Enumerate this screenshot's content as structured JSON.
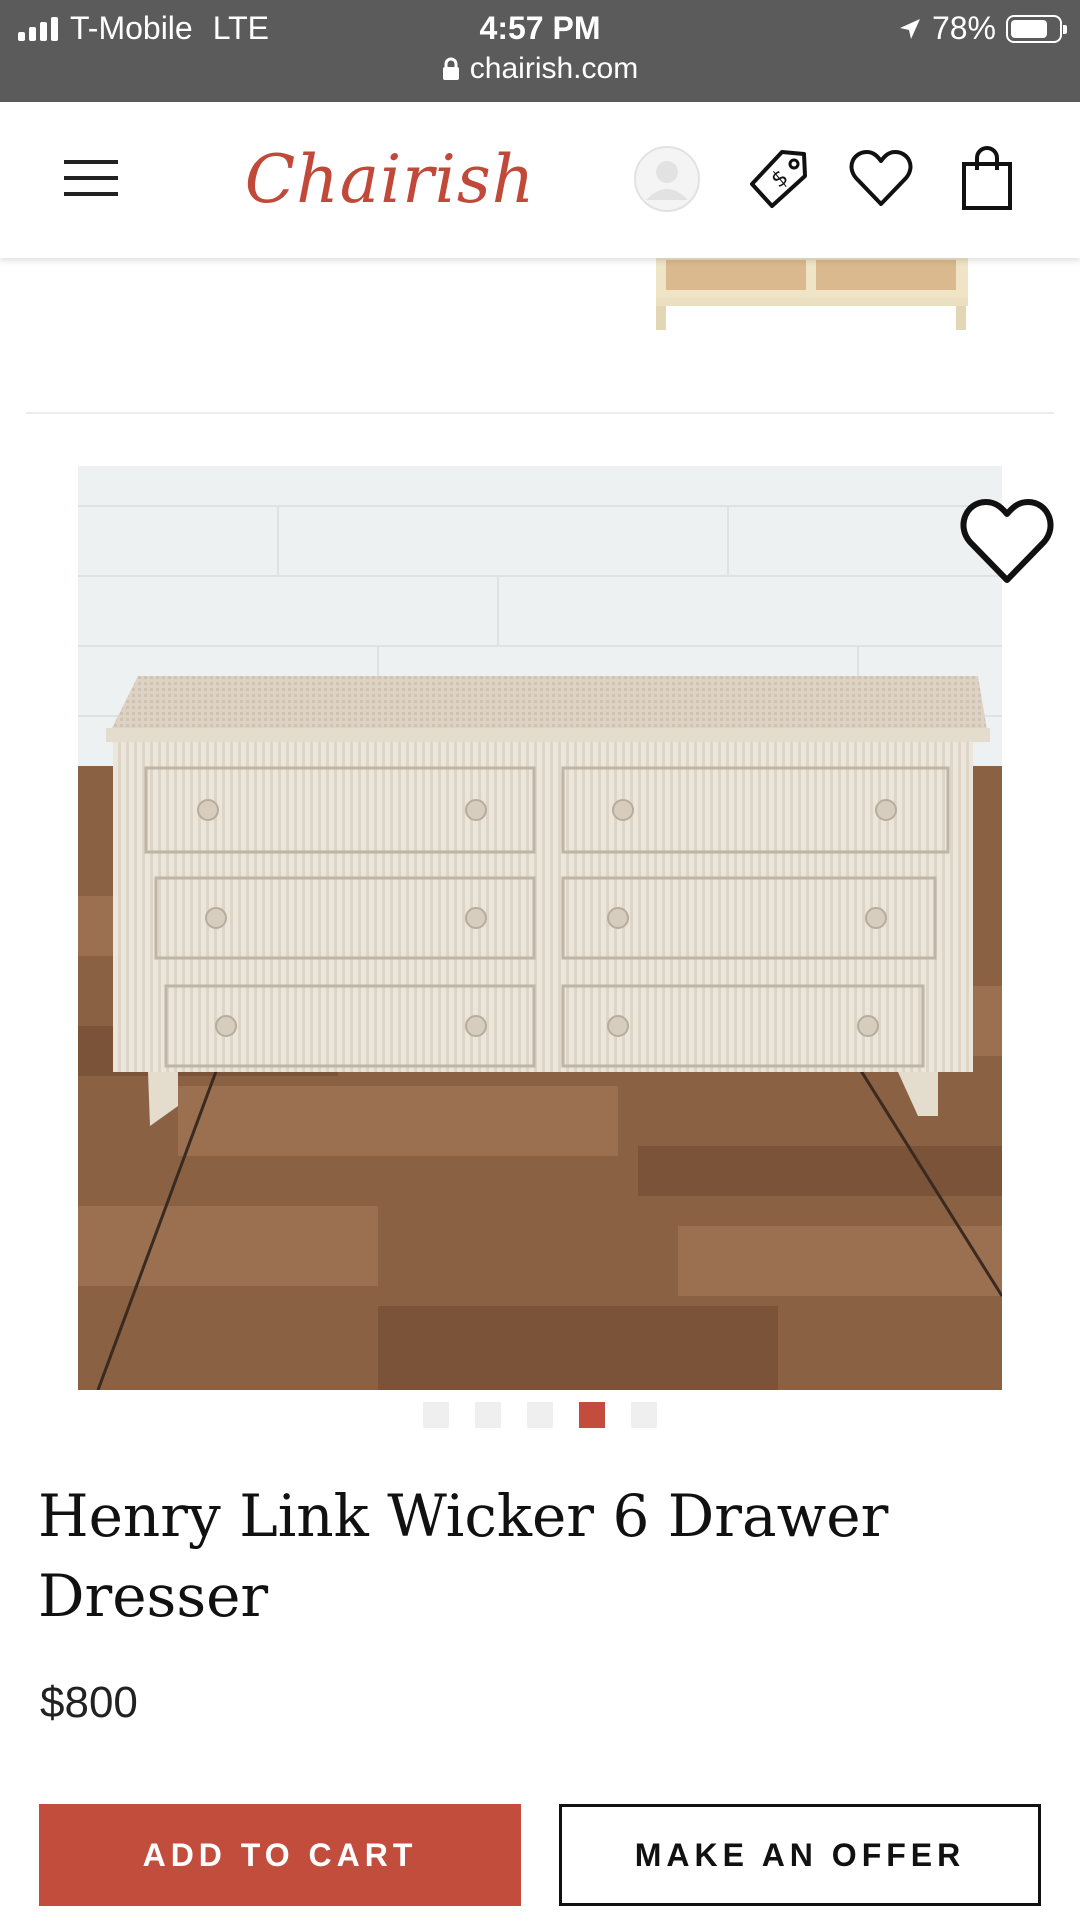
{
  "status_bar": {
    "carrier": "T-Mobile",
    "network": "LTE",
    "time": "4:57 PM",
    "url": "chairish.com",
    "battery": "78%",
    "battery_level": 0.78,
    "signal_bars": 4
  },
  "header": {
    "logo_text": "Chairish",
    "icons": [
      "menu-icon",
      "account-icon",
      "price-tag-icon",
      "heart-icon",
      "shopping-bag-icon"
    ]
  },
  "product": {
    "title": "Henry Link Wicker 6 Drawer Dresser",
    "price": "$800",
    "image_count": 5,
    "active_image_index": 3
  },
  "actions": {
    "add_to_cart": "ADD TO CART",
    "make_offer": "MAKE AN OFFER"
  },
  "colors": {
    "accent": "#c24d3d",
    "status_bar_bg": "#5b5b5b",
    "logo": "#c0493a"
  }
}
